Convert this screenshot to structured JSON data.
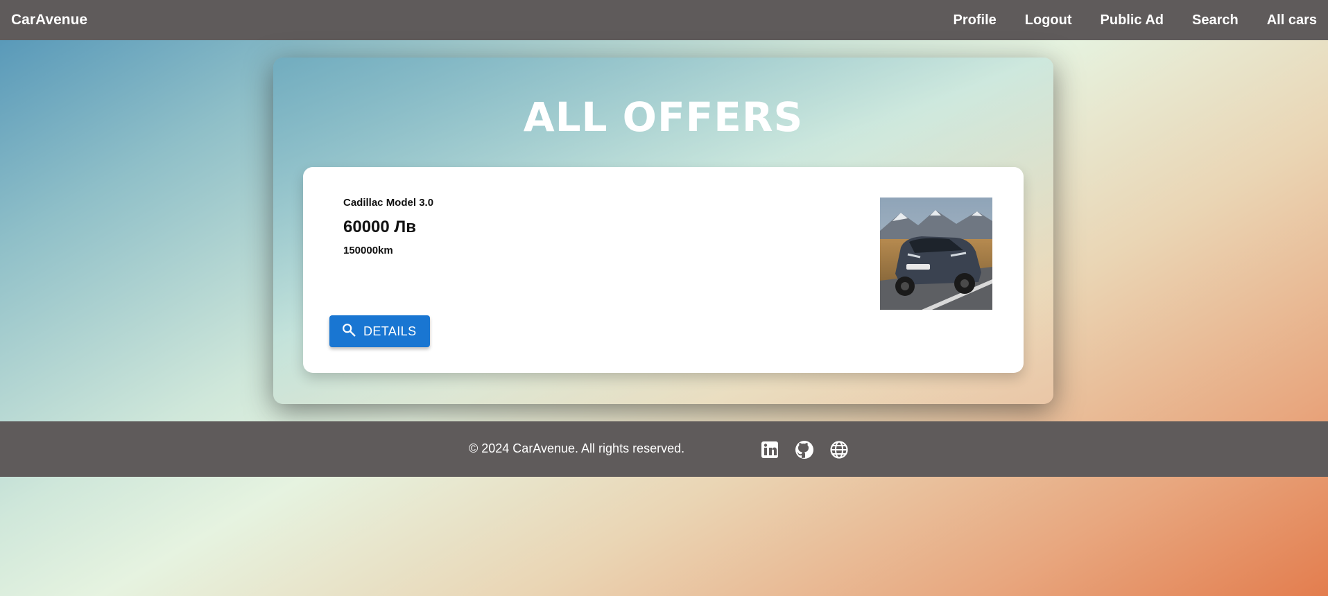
{
  "navbar": {
    "brand": "CarAvenue",
    "links": [
      {
        "label": "Profile"
      },
      {
        "label": "Logout"
      },
      {
        "label": "Public Ad"
      },
      {
        "label": "Search"
      },
      {
        "label": "All cars"
      }
    ]
  },
  "main": {
    "title": "ALL OFFERS",
    "offers": [
      {
        "model": "Cadillac Model 3.0",
        "price": "60000 Лв",
        "mileage": "150000km",
        "image_icon": "car-photo",
        "details_label": "DETAILS",
        "details_icon": "search-icon"
      }
    ]
  },
  "footer": {
    "copyright": "© 2024 CarAvenue. All rights reserved.",
    "social_icons": [
      "linkedin-icon",
      "github-icon",
      "globe-icon"
    ]
  },
  "colors": {
    "navbar_bg": "#5f5b5b",
    "button_blue": "#1976d2",
    "card_bg": "#ffffff"
  }
}
